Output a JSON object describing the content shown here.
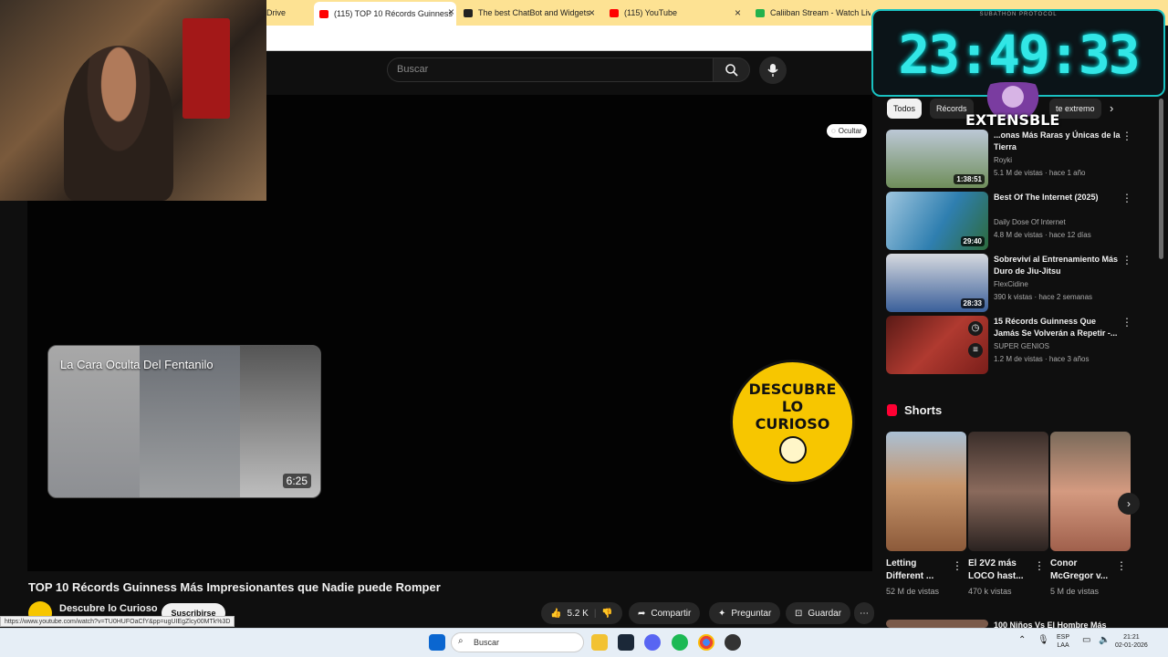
{
  "browser": {
    "tabs": [
      {
        "title": "Drive",
        "fav": "#2d8cf0"
      },
      {
        "title": "(115) TOP 10 Récords Guinness",
        "fav": "#ff0000",
        "active": true
      },
      {
        "title": "The best ChatBot and Widgets",
        "fav": "#222222"
      },
      {
        "title": "(115) YouTube",
        "fav": "#ff0000"
      },
      {
        "title": "Caliiban Stream - Watch Live o",
        "fav": "#22b14c"
      }
    ]
  },
  "youtube": {
    "search_placeholder": "Buscar",
    "player": {
      "hide_label": "Ocultar",
      "endcard_title": "La Cara Oculta Del Fentanilo",
      "endcard_duration": "6:25",
      "channel_logo_text": [
        "DESCUBRE",
        "LO",
        "CURIOSO"
      ]
    },
    "video_title": "TOP 10 Récords Guinness Más Impresionantes que Nadie puede Romper",
    "channel_name": "Descubre lo Curioso",
    "subscribe_label": "Suscribirse",
    "actions": {
      "likes": "5.2 K",
      "share": "Compartir",
      "ask": "Preguntar",
      "save": "Guardar"
    },
    "status_url": "https://www.youtube.com/watch?v=TU0HUFOaCfY&pp=ugUIEgZlcy00MTk%3D",
    "chips": [
      "Todos",
      "Récords",
      "te extremo"
    ],
    "recommendations": [
      {
        "title": "...onas Más Raras y Únicas de la Tierra",
        "channel": "Royki",
        "meta": "5.1 M de vistas · hace 1 año",
        "duration": "1:38:51",
        "color": "#6f8e5a"
      },
      {
        "title": "Best Of The Internet (2025)",
        "channel": "Daily Dose Of Internet",
        "meta": "4.8 M de vistas · hace 12 días",
        "duration": "29:40",
        "color": "#2f7fb0"
      },
      {
        "title": "Sobreviví al Entrenamiento Más Duro de Jiu-Jitsu",
        "channel": "FlexCidine",
        "meta": "390 k vistas · hace 2 semanas",
        "duration": "28:33",
        "color": "#3a5f9a"
      },
      {
        "title": "15 Récords Guinness Que Jamás Se Volverán a Repetir -...",
        "channel": "SUPER GENIOS",
        "meta": "1.2 M de vistas · hace 3 años",
        "duration": "",
        "color": "#8a2a24"
      }
    ],
    "shorts_header": "Shorts",
    "shorts": [
      {
        "title": "Letting Different ...",
        "views": "52 M de vistas",
        "color": "#b58a60"
      },
      {
        "title": "El 2V2 más LOCO hast...",
        "views": "470 k vistas",
        "color": "#5c4a44"
      },
      {
        "title": "Conor McGregor v...",
        "views": "5 M de vistas",
        "color": "#c98a72"
      }
    ],
    "next_rec_title": "100 Niños Vs El Hombre Más"
  },
  "overlay": {
    "header": "SUBATHON PROTOCOL",
    "timer": "23:49:33",
    "badge": "EXTENSBLE"
  },
  "taskbar": {
    "search": "Buscar",
    "lang": "ESP",
    "region": "LAA",
    "time": "21:21",
    "date": "02-01-2026"
  }
}
